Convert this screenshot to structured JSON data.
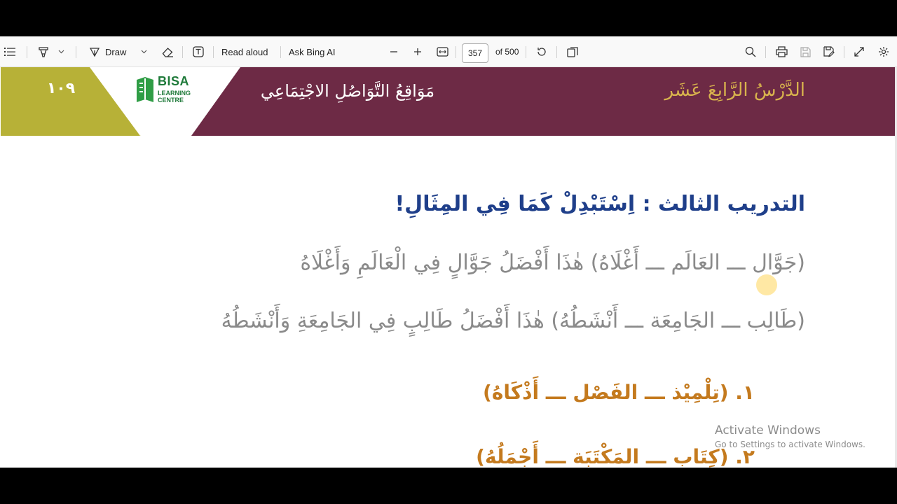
{
  "toolbar": {
    "draw_label": "Draw",
    "read_aloud_label": "Read aloud",
    "ask_bing_label": "Ask Bing AI",
    "page_current": "357",
    "page_total": "of 500"
  },
  "banner": {
    "page_number": "١٠٩",
    "lesson_label": "الدَّرْسُ الرَّابِعَ عَشَر",
    "lesson_title": "مَوَاقِعُ التَّوَاصُلِ الاجْتِمَاعِي",
    "logo_main": "BISA",
    "logo_sub_1": "LEARNING",
    "logo_sub_2": "CENTRE",
    "colors": {
      "maroon": "#6d2a45",
      "olive": "#b7b137",
      "gold": "#d8b34d"
    }
  },
  "content": {
    "exercise_title": "التدريب الثالث : اِسْتَبْدِلْ كَمَا فِي المِثَالِ!",
    "example_1": "(جَوَّال ـــ العَالَم ـــ أَغْلَاهُ) هٰذَا أَفْضَلُ جَوَّالٍ فِي الْعَالَمِ وَأَغْلَاهُ",
    "example_2": "(طَالِب ـــ الجَامِعَة ـــ أَنْشَطُهُ) هٰذَا أَفْضَلُ طَالِبٍ فِي الجَامِعَةِ وَأَنْشَطُهُ",
    "question_1": "١. (تِلْمِيْذ ـــ الفَصْل ـــ أَذْكَاهُ)",
    "question_2": "٢. (كِتَاب ـــ المَكْتَبَة ـــ أَجْمَلُهُ)"
  },
  "watermark": {
    "title": "Activate Windows",
    "subtitle": "Go to Settings to activate Windows."
  }
}
